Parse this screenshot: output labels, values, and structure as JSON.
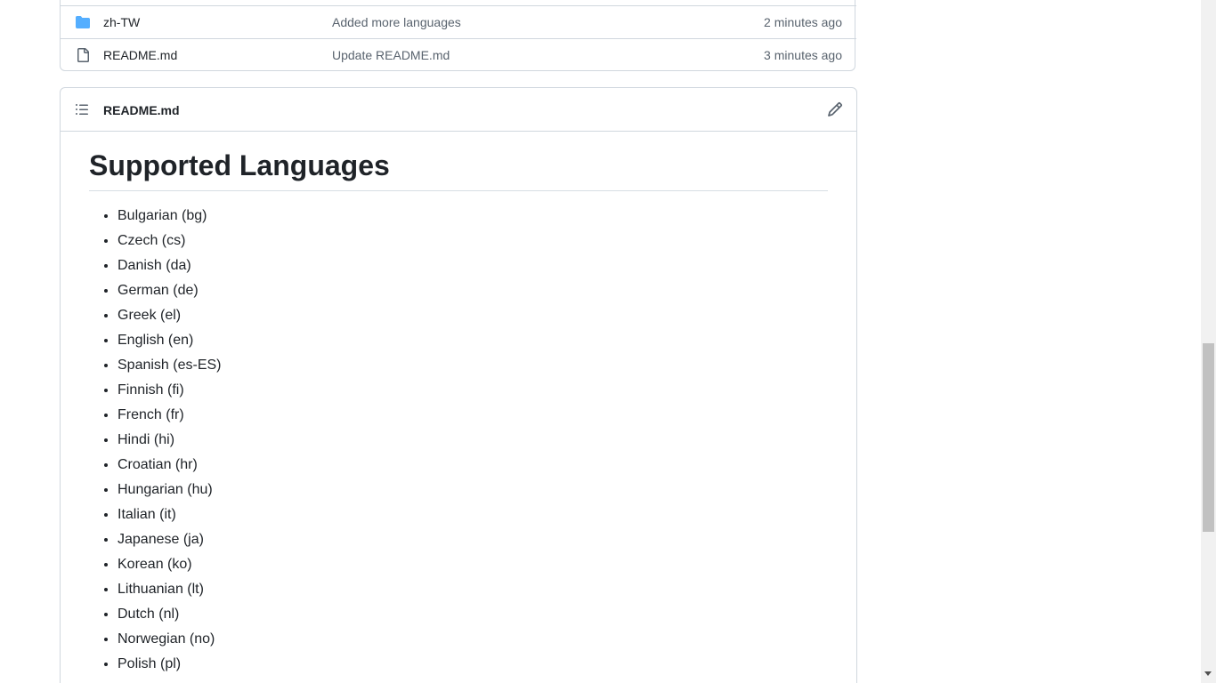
{
  "file_rows": [
    {
      "name": "zh-TW",
      "type": "folder",
      "commit": "Added more languages",
      "time": "2 minutes ago"
    },
    {
      "name": "README.md",
      "type": "file",
      "commit": "Update README.md",
      "time": "3 minutes ago"
    }
  ],
  "readme": {
    "header_title": "README.md",
    "heading": "Supported Languages",
    "languages": [
      "Bulgarian (bg)",
      "Czech (cs)",
      "Danish (da)",
      "German (de)",
      "Greek (el)",
      "English (en)",
      "Spanish (es-ES)",
      "Finnish (fi)",
      "French (fr)",
      "Hindi (hi)",
      "Croatian (hr)",
      "Hungarian (hu)",
      "Italian (it)",
      "Japanese (ja)",
      "Korean (ko)",
      "Lithuanian (lt)",
      "Dutch (nl)",
      "Norwegian (no)",
      "Polish (pl)"
    ]
  },
  "icons": {
    "folder": "folder-icon",
    "file": "file-icon",
    "toc": "table-of-contents-icon",
    "edit": "pencil-icon"
  },
  "colors": {
    "folder_blue": "#54aeff",
    "border": "#d0d7de",
    "muted_text": "#59636e",
    "text": "#1f2328"
  }
}
